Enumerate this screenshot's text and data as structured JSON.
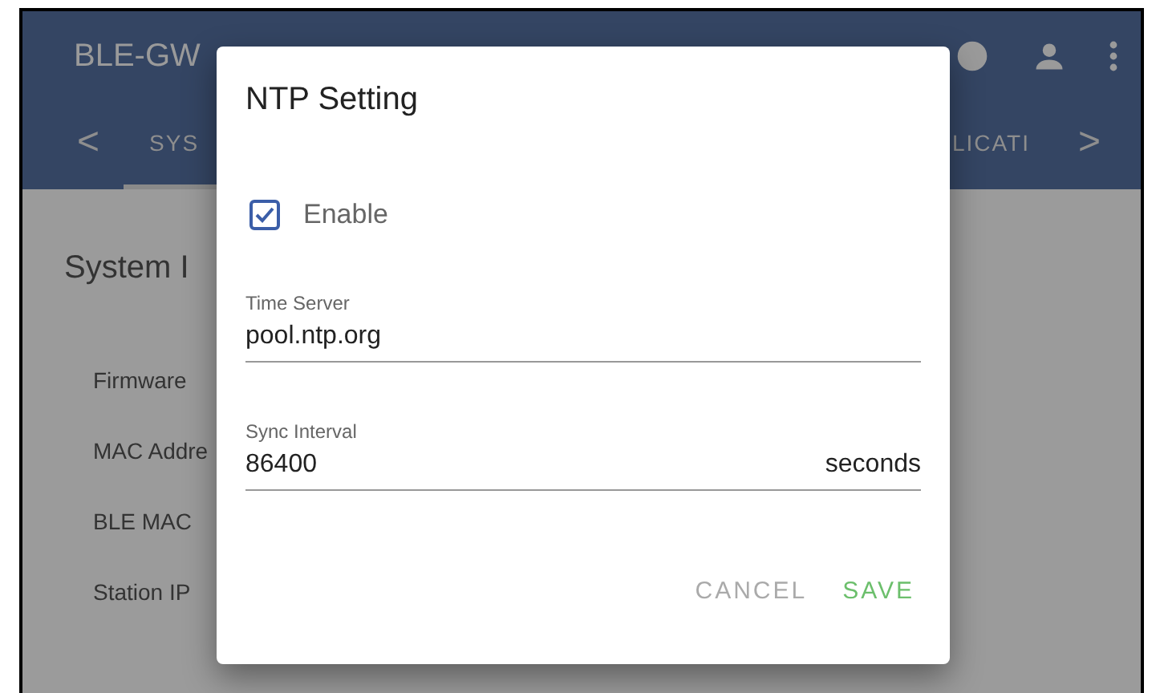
{
  "app_bar": {
    "title": "BLE-GW"
  },
  "tabs": [
    {
      "label": "<",
      "kind": "arrow",
      "selected": false
    },
    {
      "label": "SYS",
      "kind": "tab",
      "selected": true
    },
    {
      "label": "LICATI",
      "kind": "tab",
      "selected": false
    },
    {
      "label": ">",
      "kind": "arrow",
      "selected": false
    }
  ],
  "content": {
    "heading": "System I",
    "rows": [
      "Firmware",
      "MAC Addre",
      "BLE MAC",
      "Station IP"
    ]
  },
  "dialog": {
    "title": "NTP Setting",
    "enable": {
      "label": "Enable",
      "checked": true
    },
    "fields": [
      {
        "label": "Time Server",
        "value": "pool.ntp.org"
      },
      {
        "label": "Sync Interval",
        "value": "86400",
        "suffix": "seconds"
      }
    ],
    "buttons": [
      {
        "label": "CANCEL",
        "kind": "cancel"
      },
      {
        "label": "SAVE",
        "kind": "confirm"
      }
    ]
  }
}
